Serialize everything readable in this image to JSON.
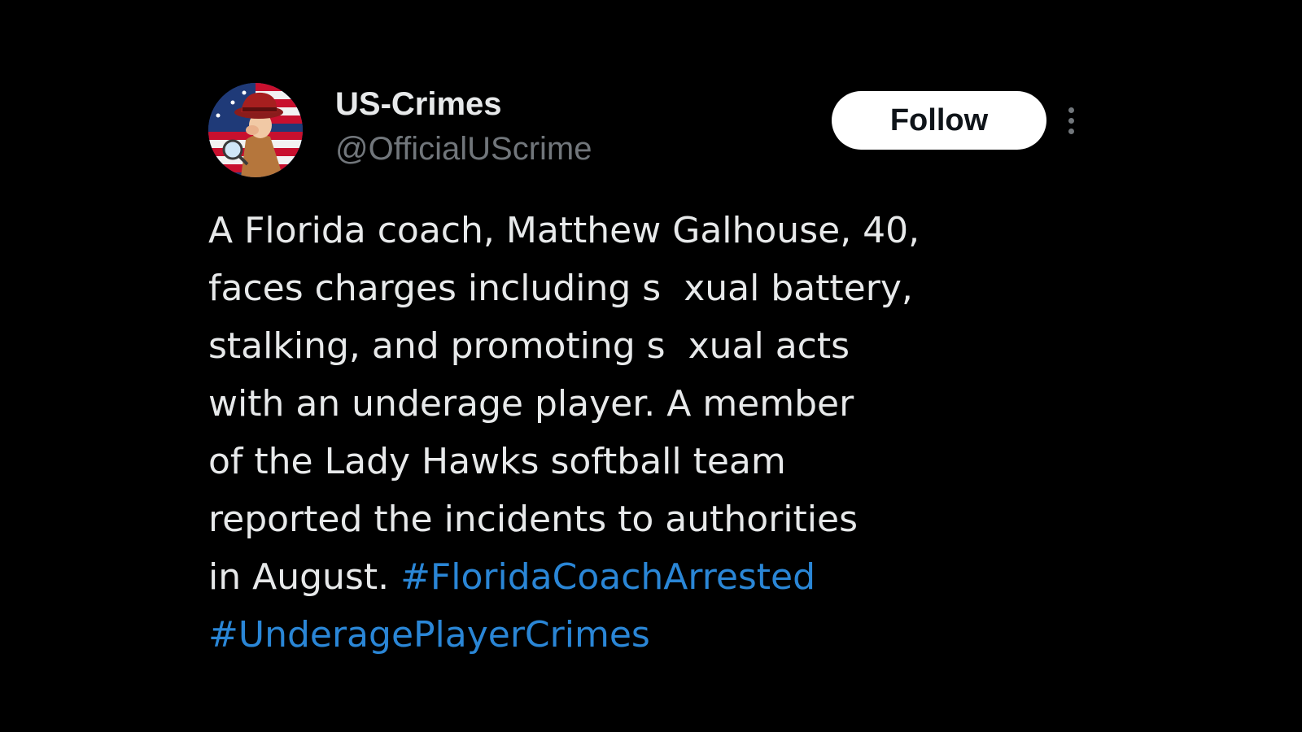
{
  "author": {
    "display_name": "US-Crimes",
    "handle": "@OfficialUScrime",
    "avatar_icon": "detective-flag-avatar"
  },
  "actions": {
    "follow_label": "Follow",
    "more_icon": "more-vertical-icon"
  },
  "post": {
    "lines": [
      "A Florida coach, Matthew Galhouse, 40,",
      [
        "faces charges including s",
        "xual battery,"
      ],
      [
        "stalking, and promoting s",
        "xual acts"
      ],
      "with an underage player. A member",
      "of the Lady Hawks softball team",
      "reported the incidents to authorities",
      "in August."
    ],
    "hashtags": [
      "#FloridaCoachArrested",
      "#UnderagePlayerCrimes"
    ]
  },
  "colors": {
    "background": "#000000",
    "text": "#e7e9ea",
    "secondary_text": "#71767b",
    "hashtag": "#2a86d6",
    "follow_bg": "#ffffff"
  }
}
